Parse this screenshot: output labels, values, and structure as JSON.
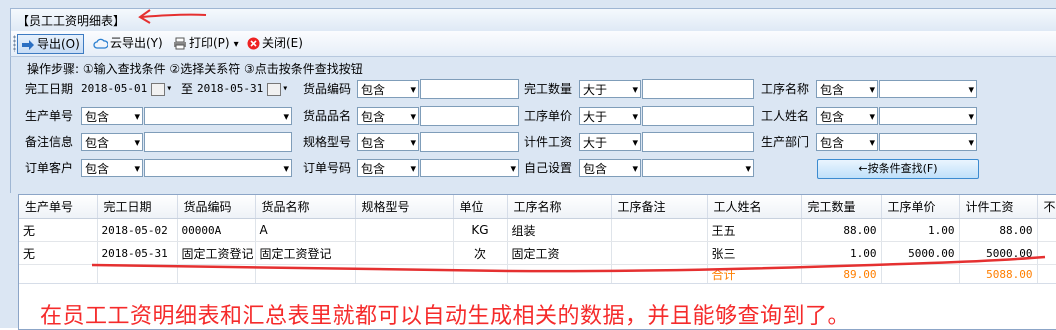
{
  "window": {
    "title": "【员工工资明细表】"
  },
  "toolbar": {
    "export_label": "导出(O)",
    "cloud_export_label": "云导出(Y)",
    "print_label": "打印(P)",
    "close_label": "关闭(E)"
  },
  "steps": "操作步骤:  ①输入查找条件  ②选择关系符  ③点击按条件查找按钮",
  "filters": {
    "finish_date": {
      "label": "完工日期",
      "from": "2018-05-01",
      "to_label": "至",
      "to": "2018-05-31"
    },
    "goods_code": {
      "label": "货品编码",
      "op": "包含"
    },
    "finish_qty": {
      "label": "完工数量",
      "op": "大于"
    },
    "process_name": {
      "label": "工序名称",
      "op": "包含"
    },
    "prod_no": {
      "label": "生产单号",
      "op": "包含"
    },
    "goods_name": {
      "label": "货品品名",
      "op": "包含"
    },
    "unit_price": {
      "label": "工序单价",
      "op": "大于"
    },
    "worker_name": {
      "label": "工人姓名",
      "op": "包含"
    },
    "remark": {
      "label": "备注信息",
      "op": "包含"
    },
    "spec": {
      "label": "规格型号",
      "op": "包含"
    },
    "piece_wage": {
      "label": "计件工资",
      "op": "大于"
    },
    "dept": {
      "label": "生产部门",
      "op": "包含"
    },
    "customer": {
      "label": "订单客户",
      "op": "包含"
    },
    "order_no": {
      "label": "订单号码",
      "op": "包含"
    },
    "custom": {
      "label": "自己设置",
      "op": "包含"
    },
    "search_button": "←按条件查找(F)"
  },
  "table": {
    "headers": [
      "生产单号",
      "完工日期",
      "货品编码",
      "货品名称",
      "规格型号",
      "单位",
      "工序名称",
      "工序备注",
      "工人姓名",
      "完工数量",
      "工序单价",
      "计件工资",
      "不"
    ],
    "rows": [
      [
        "无",
        "2018-05-02",
        "00000A",
        "A",
        "",
        "KG",
        "组装",
        "",
        "王五",
        "88.00",
        "1.00",
        "88.00"
      ],
      [
        "无",
        "2018-05-31",
        "固定工资登记",
        "固定工资登记",
        "",
        "次",
        "固定工资",
        "",
        "张三",
        "1.00",
        "5000.00",
        "5000.00"
      ]
    ],
    "total": {
      "label": "合计",
      "qty": "89.00",
      "wage": "5088.00"
    }
  },
  "annotation": "在员工工资明细表和汇总表里就都可以自动生成相关的数据，并且能够查询到了。",
  "colors": {
    "annotation": "#f52b2b",
    "total": "#ff7f00",
    "panel": "#dbe6f3"
  }
}
